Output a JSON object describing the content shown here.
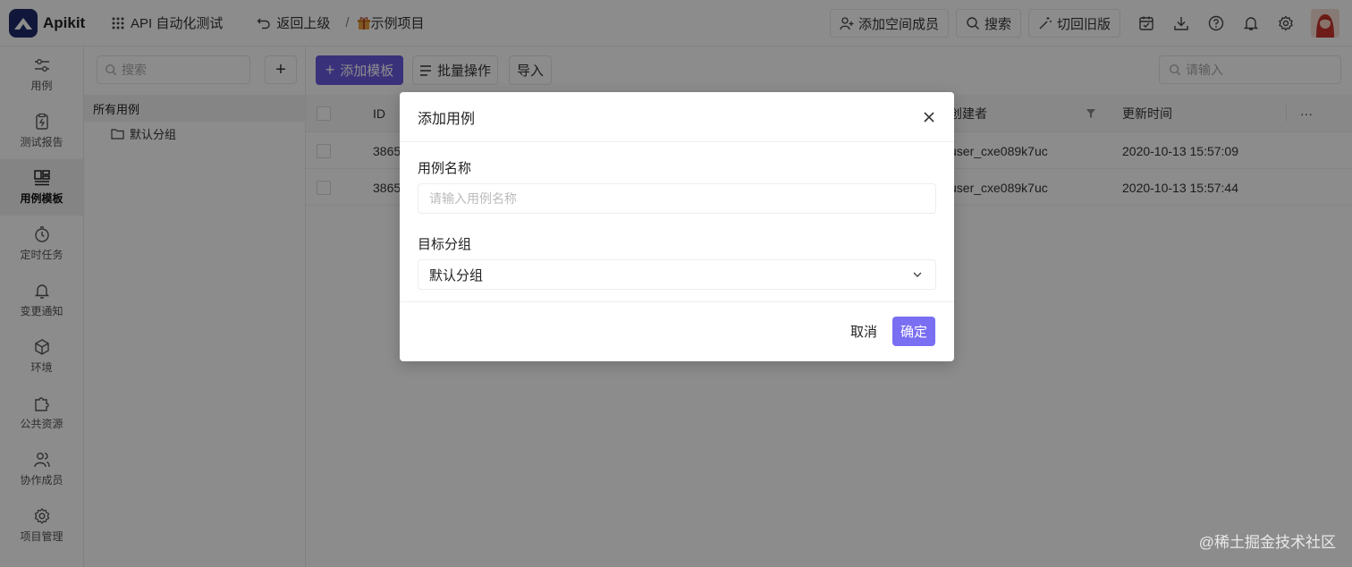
{
  "app": {
    "name": "Apikit",
    "brand_color": "#1f2a6b",
    "accent_color": "#6a5ae0"
  },
  "header": {
    "space_name": "API 自动化测试",
    "back_label": "返回上级",
    "separator": "/",
    "project_name": "示例项目",
    "add_member_label": "添加空间成员",
    "search_label": "搜索",
    "switch_label": "切回旧版",
    "icons": [
      "calendar-icon",
      "download-icon",
      "help-icon",
      "bell-icon",
      "gear-icon"
    ]
  },
  "sidebar": {
    "items": [
      {
        "label": "用例",
        "icon": "sliders-icon",
        "active": false
      },
      {
        "label": "测试报告",
        "icon": "report-icon",
        "active": false
      },
      {
        "label": "用例模板",
        "icon": "template-icon",
        "active": true
      },
      {
        "label": "定时任务",
        "icon": "timer-icon",
        "active": false
      },
      {
        "label": "变更通知",
        "icon": "bell-icon",
        "active": false
      },
      {
        "label": "环境",
        "icon": "cube-icon",
        "active": false
      },
      {
        "label": "公共资源",
        "icon": "puzzle-icon",
        "active": false
      },
      {
        "label": "协作成员",
        "icon": "users-icon",
        "active": false
      },
      {
        "label": "项目管理",
        "icon": "gear-icon",
        "active": false
      }
    ]
  },
  "tree": {
    "search_placeholder": "搜索",
    "add_label": "+",
    "all_label": "所有用例",
    "groups": [
      "默认分组"
    ]
  },
  "toolbar": {
    "add_template_label": "添加模板",
    "batch_label": "批量操作",
    "import_label": "导入",
    "search_placeholder": "请输入"
  },
  "table": {
    "columns": {
      "id": "ID",
      "creator": "创建者",
      "updated": "更新时间",
      "more": "···"
    },
    "rows": [
      {
        "id": "3865",
        "creator": "user_cxe089k7uc",
        "updated": "2020-10-13 15:57:09"
      },
      {
        "id": "3865",
        "creator": "user_cxe089k7uc",
        "updated": "2020-10-13 15:57:44"
      }
    ]
  },
  "modal": {
    "title": "添加用例",
    "name_label": "用例名称",
    "name_placeholder": "请输入用例名称",
    "group_label": "目标分组",
    "group_value": "默认分组",
    "cancel_label": "取消",
    "ok_label": "确定"
  },
  "watermark": "@稀土掘金技术社区"
}
